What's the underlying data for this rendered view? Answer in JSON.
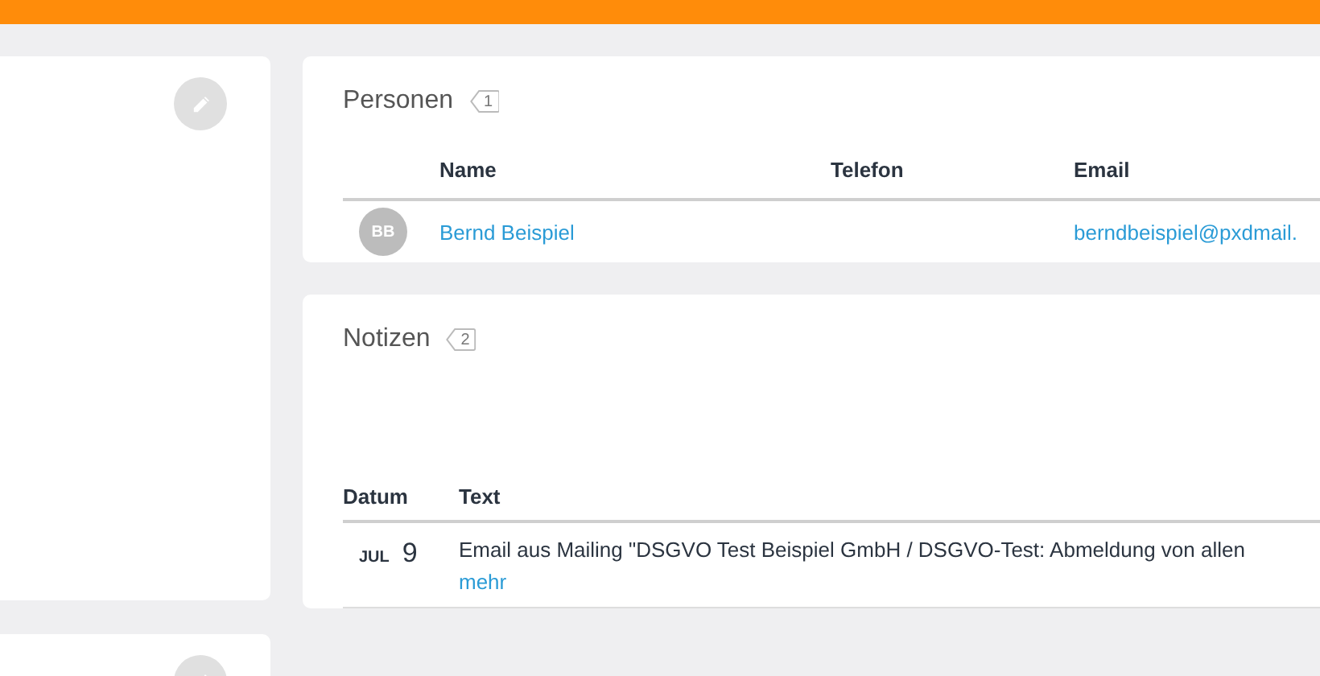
{
  "persons": {
    "title": "Personen",
    "count": "1",
    "columns": [
      "Name",
      "Telefon",
      "Email"
    ],
    "rows": [
      {
        "initials": "BB",
        "name": "Bernd Beispiel",
        "email": "berndbeispiel@pxdmail."
      }
    ]
  },
  "notes": {
    "title": "Notizen",
    "count": "2",
    "columns": [
      "Datum",
      "Text"
    ],
    "rows": [
      {
        "month": "JUL",
        "day": "9",
        "text": "Email aus Mailing \"DSGVO Test Beispiel GmbH / DSGVO-Test: Abmeldung von allen",
        "more": "mehr"
      }
    ]
  }
}
